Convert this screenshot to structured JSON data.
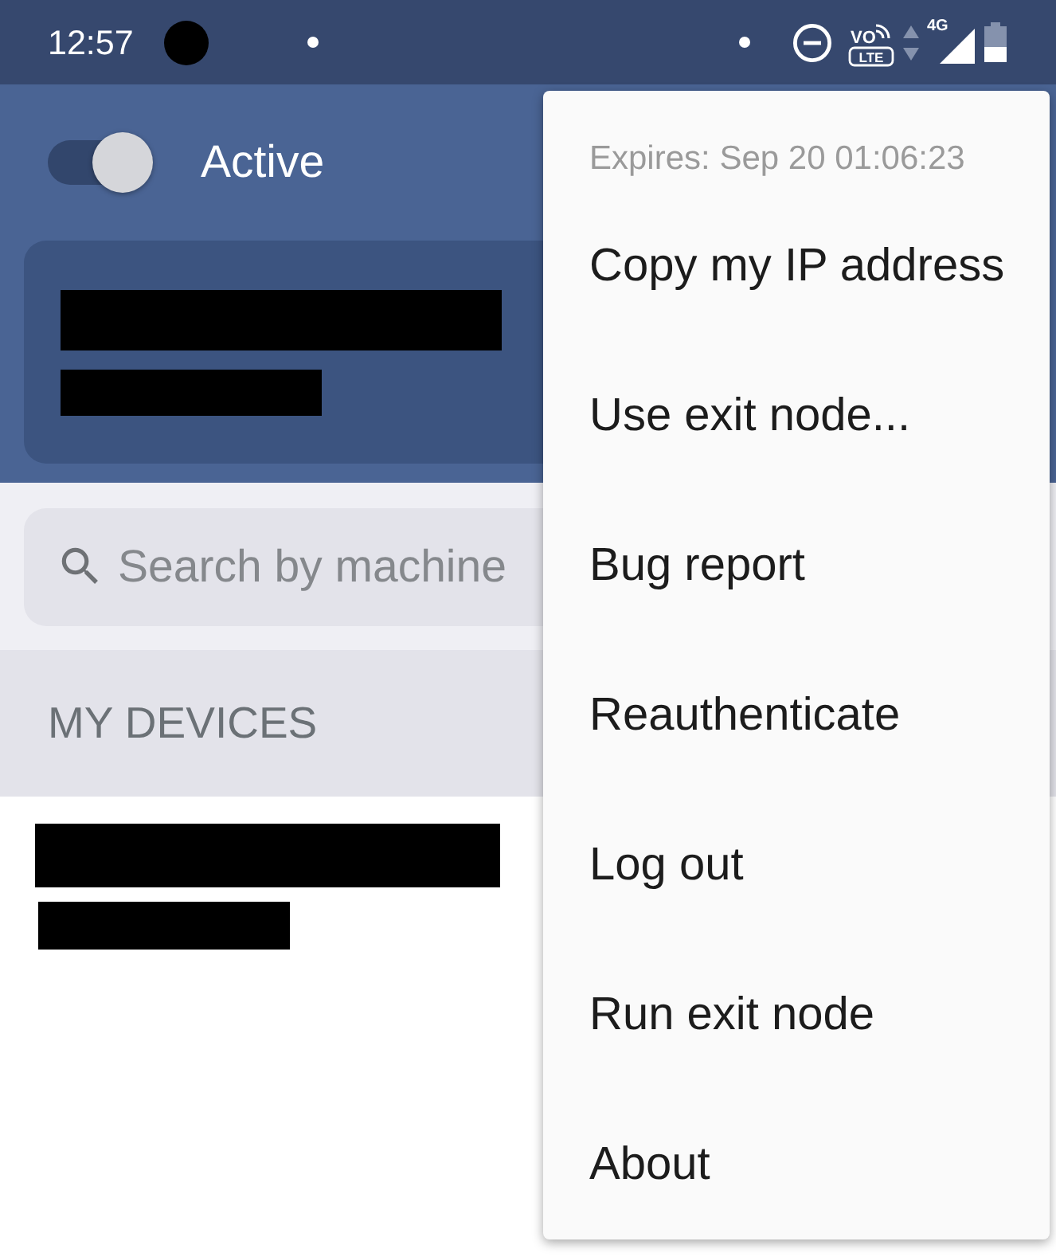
{
  "status_bar": {
    "time": "12:57",
    "volte": {
      "top": "VO",
      "bottom": "LTE"
    },
    "network": "4G"
  },
  "header": {
    "toggle": {
      "on": true,
      "label": "Active"
    },
    "account_card": {
      "lines": [
        {
          "kind": "redacted"
        },
        {
          "kind": "redacted"
        }
      ]
    }
  },
  "search": {
    "placeholder": "Search by machine"
  },
  "devices": {
    "heading": "MY DEVICES",
    "items": [
      {
        "lines": [
          {
            "kind": "redacted"
          },
          {
            "kind": "redacted"
          }
        ]
      }
    ]
  },
  "menu": {
    "expires": "Expires: Sep 20 01:06:23",
    "items": [
      "Copy my IP address",
      "Use exit node...",
      "Bug report",
      "Reauthenticate",
      "Log out",
      "Run exit node",
      "About"
    ]
  }
}
